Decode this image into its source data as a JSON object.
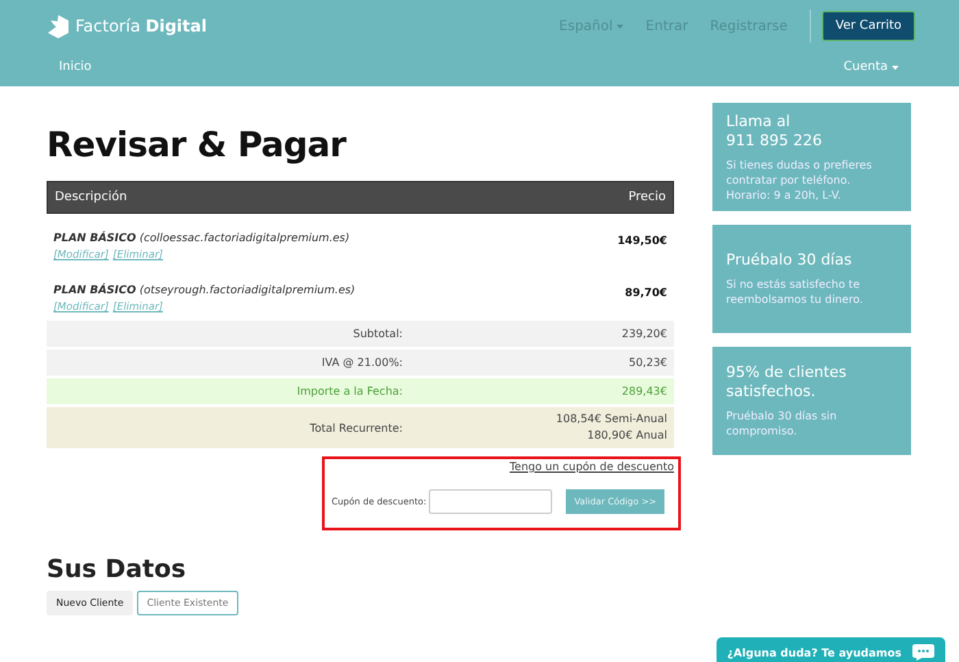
{
  "header": {
    "logo": {
      "brand": "Factoría",
      "brand_bold": "Digital"
    },
    "nav": [
      {
        "label": "Español",
        "dropdown": true
      },
      {
        "label": "Entrar",
        "dropdown": false
      },
      {
        "label": "Registrarse",
        "dropdown": false
      }
    ],
    "cart_button": "Ver Carrito",
    "subnav_left": "Inicio",
    "subnav_right": {
      "label": "Cuenta",
      "dropdown": true
    }
  },
  "title": "Revisar & Pagar",
  "table": {
    "columns": [
      "Descripción",
      "Precio"
    ],
    "items": [
      {
        "plan": "PLAN BÁSICO",
        "domain": "(colloessac.factoriadigitalpremium.es)",
        "links": [
          "[Modificar]",
          "[Eliminar]"
        ],
        "price": "149,50€"
      },
      {
        "plan": "PLAN BÁSICO",
        "domain": "(otseyrough.factoriadigitalpremium.es)",
        "links": [
          "[Modificar]",
          "[Eliminar]"
        ],
        "price": "89,70€"
      }
    ],
    "summary": [
      {
        "kind": "plain",
        "label": "Subtotal:",
        "values": [
          "239,20€"
        ]
      },
      {
        "kind": "plain",
        "label": "IVA @ 21.00%:",
        "values": [
          "50,23€"
        ]
      },
      {
        "kind": "highlight",
        "label": "Importe a la Fecha:",
        "values": [
          "289,43€"
        ]
      },
      {
        "kind": "recurring",
        "label": "Total Recurrente:",
        "values": [
          "108,54€ Semi-Anual",
          "180,90€ Anual"
        ]
      }
    ]
  },
  "coupon": {
    "toggle_link": "Tengo un cupón de descuento",
    "label": "Cupón de descuento:",
    "button": "Validar Código >>"
  },
  "details": {
    "title": "Sus Datos",
    "tabs": [
      {
        "label": "Nuevo Cliente",
        "selected": true
      },
      {
        "label": "Cliente Existente",
        "selected": false
      }
    ]
  },
  "sidebar": [
    {
      "heading": [
        "Llama al",
        "911 895 226"
      ],
      "text": "Si tienes dudas o prefieres contratar por teléfono. Horario: 9 a 20h, L-V."
    },
    {
      "heading": [
        "Pruébalo 30 días"
      ],
      "text": "Si no estás satisfecho te reembolsamos tu dinero."
    },
    {
      "heading": [
        "95% de clientes",
        "satisfechos."
      ],
      "text": "Pruébalo 30 días sin compromiso."
    }
  ],
  "chat_button": "¿Alguna duda? Te ayudamos"
}
